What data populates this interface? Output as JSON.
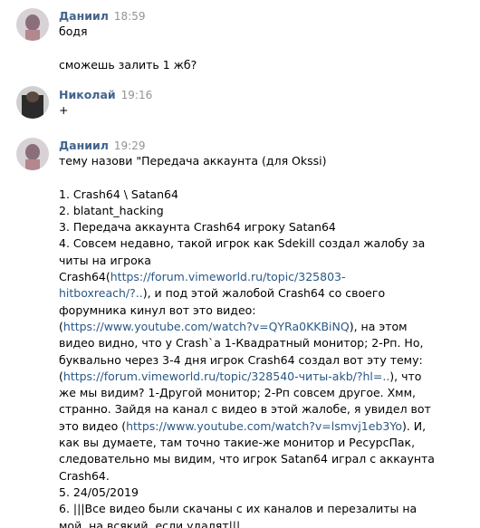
{
  "messages": [
    {
      "author": "Даниил",
      "time": "18:59",
      "avatar": "avatar-daniil",
      "lines": [
        "бодя",
        "",
        "сможешь залить 1 жб?"
      ]
    },
    {
      "author": "Николай",
      "time": "19:16",
      "avatar": "avatar-nikolay",
      "lines": [
        "+"
      ]
    },
    {
      "author": "Даниил",
      "time": "19:29",
      "avatar": "avatar-daniil",
      "intro": "тему назови \"Передача аккаунта (для Okssi)",
      "l1": "1. Crash64 \\ Satan64",
      "l2": "2. blatant_hacking",
      "l3": "3. Передача аккаунта Crash64 игроку Satan64",
      "l4": "4. Совсем недавно, такой игрок как Sdekill создал жалобу за",
      "l5": "читы на игрока",
      "l6a": "Crash64(",
      "l6link": "https://forum.vimeworld.ru/topic/325803-",
      "l7link": "hitboxreach/?..",
      "l7b": "), и под этой жалобой Crash64 со своего",
      "l8": "форумника кинул вот это видео:",
      "l9a": "(",
      "l9link": "https://www.youtube.com/watch?v=QYRa0KKBiNQ",
      "l9b": "), на этом",
      "l10": "видео видно, что у Crash`а 1-Квадратный монитор; 2-Рп. Но,",
      "l11": "буквально через 3-4 дня игрок Crash64 создал вот эту тему:",
      "l12a": "(",
      "l12link": "https://forum.vimeworld.ru/topic/328540-читы-akb/?hl=..",
      "l12b": "), что",
      "l13": "же мы видим? 1-Другой монитор; 2-Рп совсем другое. Хмм,",
      "l14": "странно. Зайдя на канал с видео в этой жалобе, я увидел вот",
      "l15a": "это видео (",
      "l15link": "https://www.youtube.com/watch?v=lsmvj1eb3Yo",
      "l15b": "). И,",
      "l16": "как вы думаете, там точно такие-же монитор и РесурсПак,",
      "l17": "следовательно мы видим, что игрок Satan64 играл с аккаунта",
      "l18": "Crash64.",
      "l19": "5. 24/05/2019",
      "l20": "6. |||Все видео были скачаны с их каналов и перезалиты на",
      "l21": "мой, на всякий, если удалят|||"
    }
  ]
}
